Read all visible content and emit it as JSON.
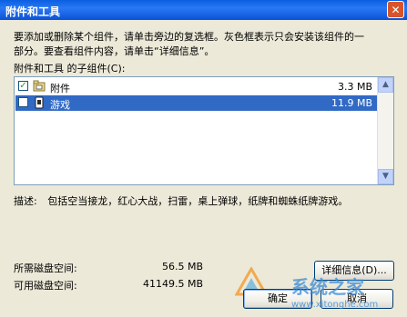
{
  "window": {
    "title": "附件和工具"
  },
  "instructions": {
    "line1": "要添加或删除某个组件，请单击旁边的复选框。灰色框表示只会安装该组件的一",
    "line2": "部分。要查看组件内容，请单击“详细信息”。"
  },
  "components": {
    "label": "附件和工具 的子组件(C):",
    "items": [
      {
        "label": "附件",
        "size": "3.3 MB",
        "checked": true,
        "selected": false,
        "icon": "accessories-folder-icon"
      },
      {
        "label": "游戏",
        "size": "11.9 MB",
        "checked": false,
        "selected": true,
        "icon": "games-icon"
      }
    ]
  },
  "description": {
    "label": "描述:",
    "text": "包括空当接龙，红心大战，扫雷，桌上弹球，纸牌和蜘蛛纸牌游戏。"
  },
  "disk": {
    "required_label": "所需磁盘空间:",
    "required_value": "56.5 MB",
    "available_label": "可用磁盘空间:",
    "available_value": "41149.5 MB"
  },
  "buttons": {
    "details": "详细信息(D)...",
    "ok": "确定",
    "cancel": "取消"
  },
  "watermark": {
    "text": "系统之家",
    "url": "www.xitonghe.com"
  },
  "colors": {
    "titlebar": "#0a5fe0",
    "selection": "#316ac5",
    "dialog": "#ece9d8"
  }
}
